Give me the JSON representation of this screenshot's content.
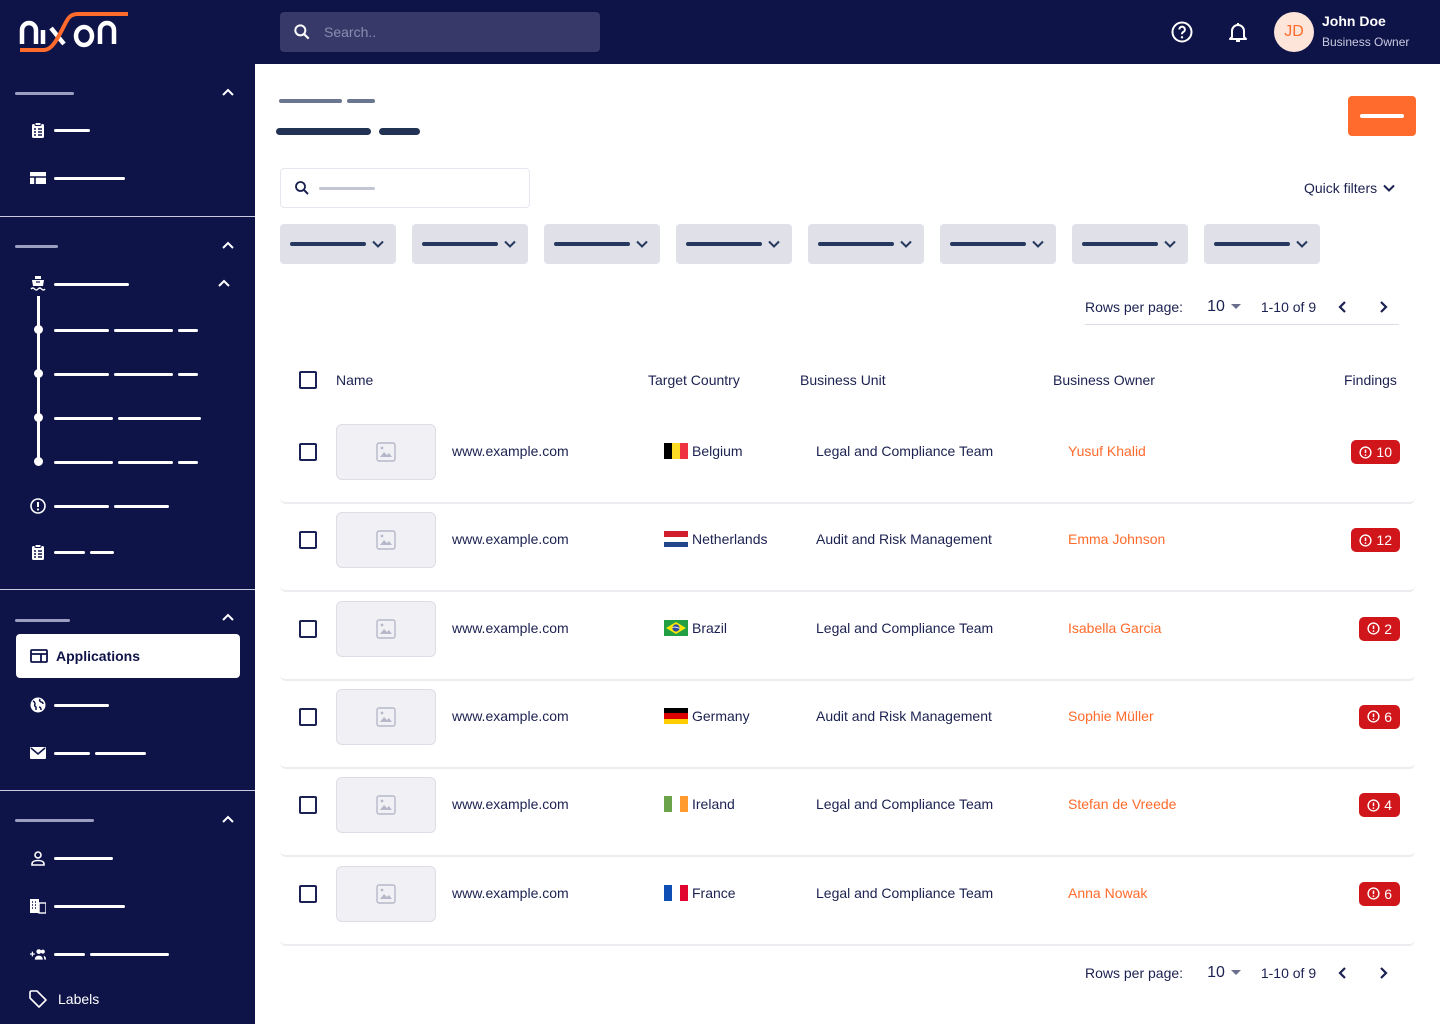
{
  "app": {
    "brand": "nixon",
    "brand_accent": "#ff6b2c",
    "nav_bg": "#0e1348"
  },
  "topbar": {
    "search_placeholder": "Search..",
    "icons": [
      "help-circle-icon",
      "bell-icon"
    ],
    "user": {
      "initials": "JD",
      "name": "John Doe",
      "role": "Business Owner"
    }
  },
  "sidebar": {
    "sections": [
      {
        "title_redacted": true,
        "items": [
          {
            "icon": "clipboard-list-icon"
          },
          {
            "icon": "table-layout-icon"
          }
        ]
      },
      {
        "title_redacted": true,
        "items": [
          {
            "icon": "ship-icon",
            "expanded": true,
            "children": 4
          },
          {
            "icon": "alert-circle-icon"
          },
          {
            "icon": "clipboard-list-icon"
          }
        ]
      },
      {
        "title_redacted": true,
        "items": [
          {
            "icon": "application-icon",
            "label": "Applications",
            "active": true
          },
          {
            "icon": "globe-icon"
          },
          {
            "icon": "mail-icon"
          }
        ]
      },
      {
        "title_redacted": true,
        "items": [
          {
            "icon": "user-icon"
          },
          {
            "icon": "building-icon"
          },
          {
            "icon": "group-add-icon"
          },
          {
            "icon": "tag-icon",
            "label": "Labels"
          }
        ]
      }
    ]
  },
  "main": {
    "quick_filters_label": "Quick filters",
    "filter_chip_count": 8,
    "pagination": {
      "rows_per_page_label": "Rows per page:",
      "rows_per_page": "10",
      "range": "1-10 of 9"
    },
    "table": {
      "columns": [
        "Name",
        "Target Country",
        "Business Unit",
        "Business Owner",
        "Findings"
      ],
      "rows": [
        {
          "name": "www.example.com",
          "country": "Belgium",
          "unit": "Legal and Compliance Team",
          "owner": "Yusuf Khalid",
          "findings": "10"
        },
        {
          "name": "www.example.com",
          "country": "Netherlands",
          "unit": "Audit and Risk Management",
          "owner": "Emma Johnson",
          "findings": "12"
        },
        {
          "name": "www.example.com",
          "country": "Brazil",
          "unit": "Legal and Compliance Team",
          "owner": "Isabella Garcia",
          "findings": "2"
        },
        {
          "name": "www.example.com",
          "country": "Germany",
          "unit": "Audit and Risk Management",
          "owner": "Sophie Müller",
          "findings": "6"
        },
        {
          "name": "www.example.com",
          "country": "Ireland",
          "unit": "Legal and Compliance Team",
          "owner": "Stefan de Vreede",
          "findings": "4"
        },
        {
          "name": "www.example.com",
          "country": "France",
          "unit": "Legal and Compliance Team",
          "owner": "Anna Nowak",
          "findings": "6"
        }
      ]
    }
  }
}
